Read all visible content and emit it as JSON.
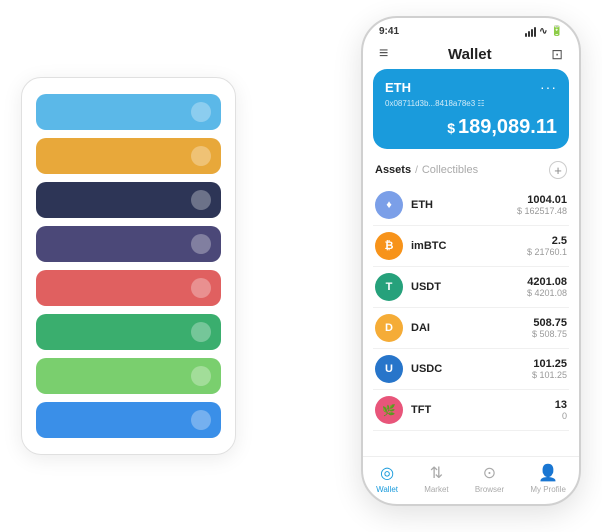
{
  "scene": {
    "card_stack": {
      "cards": [
        {
          "color": "#5bb8e8",
          "icon_label": ""
        },
        {
          "color": "#e8a83a",
          "icon_label": ""
        },
        {
          "color": "#2d3556",
          "icon_label": ""
        },
        {
          "color": "#4b4878",
          "icon_label": ""
        },
        {
          "color": "#e06060",
          "icon_label": ""
        },
        {
          "color": "#3aae6e",
          "icon_label": ""
        },
        {
          "color": "#7acf6e",
          "icon_label": ""
        },
        {
          "color": "#3a8fe8",
          "icon_label": ""
        }
      ]
    },
    "phone": {
      "status_bar": {
        "time": "9:41",
        "signal": "●●●",
        "wifi": "▲",
        "battery": "■"
      },
      "nav": {
        "menu_icon": "≡",
        "title": "Wallet",
        "expand_icon": "⊡"
      },
      "eth_card": {
        "title": "ETH",
        "dots": "···",
        "address": "0x08711d3b...8418a78e3 ☷",
        "balance_symbol": "$",
        "balance": "189,089.11"
      },
      "assets_section": {
        "tab_active": "Assets",
        "tab_separator": "/",
        "tab_inactive": "Collectibles",
        "add_button": "+"
      },
      "assets": [
        {
          "name": "ETH",
          "amount": "1004.01",
          "usd": "$ 162517.48",
          "logo_color": "#7b9fe8",
          "logo_text": "♦"
        },
        {
          "name": "imBTC",
          "amount": "2.5",
          "usd": "$ 21760.1",
          "logo_color": "#f7931a",
          "logo_text": "₿"
        },
        {
          "name": "USDT",
          "amount": "4201.08",
          "usd": "$ 4201.08",
          "logo_color": "#26a17b",
          "logo_text": "T"
        },
        {
          "name": "DAI",
          "amount": "508.75",
          "usd": "$ 508.75",
          "logo_color": "#f5ac37",
          "logo_text": "D"
        },
        {
          "name": "USDC",
          "amount": "101.25",
          "usd": "$ 101.25",
          "logo_color": "#2775ca",
          "logo_text": "U"
        },
        {
          "name": "TFT",
          "amount": "13",
          "usd": "0",
          "logo_color": "#e8557a",
          "logo_text": "🌿"
        }
      ],
      "bottom_nav": [
        {
          "icon": "◎",
          "label": "Wallet",
          "active": true
        },
        {
          "icon": "↑↓",
          "label": "Market",
          "active": false
        },
        {
          "icon": "⊙",
          "label": "Browser",
          "active": false
        },
        {
          "icon": "👤",
          "label": "My Profile",
          "active": false
        }
      ]
    }
  }
}
